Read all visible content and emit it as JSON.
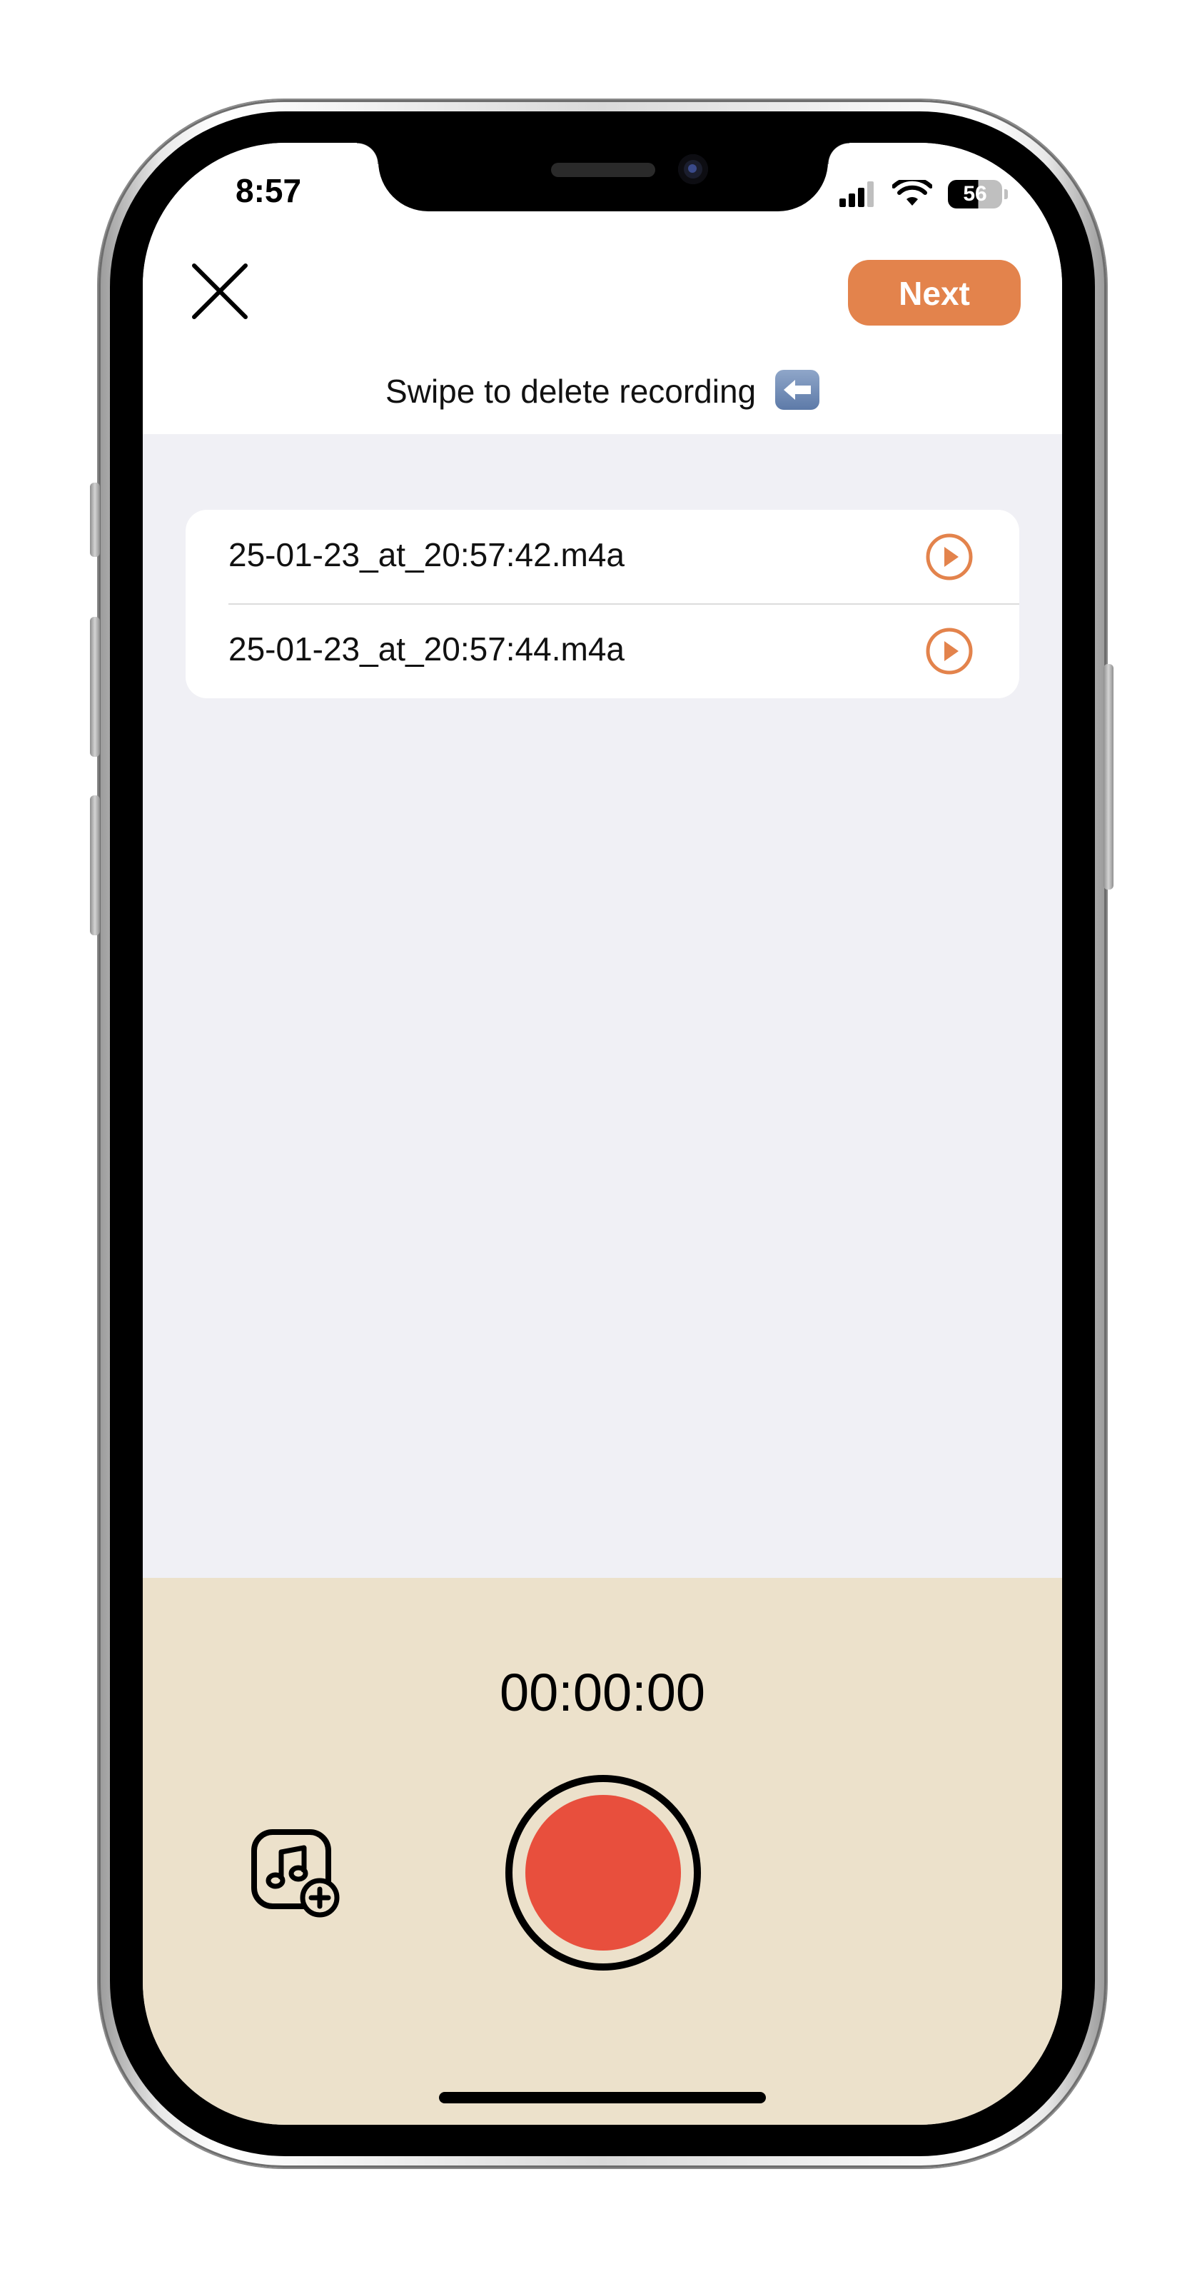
{
  "status_bar": {
    "time": "8:57",
    "battery_level": "56"
  },
  "header": {
    "next_label": "Next",
    "hint_text": "Swipe to delete recording"
  },
  "recordings": [
    {
      "filename": "25-01-23_at_20:57:42.m4a"
    },
    {
      "filename": "25-01-23_at_20:57:44.m4a"
    }
  ],
  "recorder": {
    "timer": "00:00:00"
  },
  "colors": {
    "accent": "#e3834c",
    "record": "#e84f3d",
    "panel": "#ece1cb",
    "list_bg": "#f0f0f5"
  },
  "icons": {
    "close": "close-icon",
    "play": "play-icon",
    "add_music": "add-music-icon",
    "hint_arrow": "left-arrow-icon"
  }
}
